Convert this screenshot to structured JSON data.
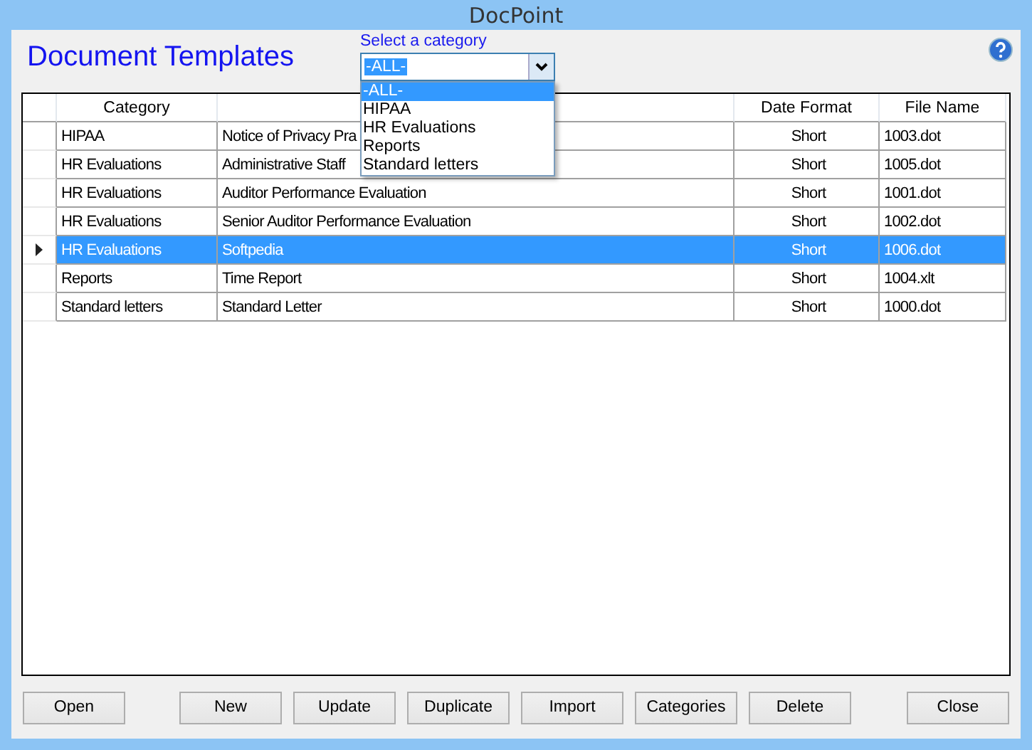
{
  "window": {
    "title": "DocPoint"
  },
  "heading": "Document Templates",
  "category_filter": {
    "label": "Select a category",
    "value": "-ALL-",
    "expanded": true,
    "options": [
      {
        "label": "-ALL-",
        "selected": true
      },
      {
        "label": "HIPAA",
        "selected": false
      },
      {
        "label": "HR Evaluations",
        "selected": false
      },
      {
        "label": "Reports",
        "selected": false
      },
      {
        "label": "Standard letters",
        "selected": false
      }
    ]
  },
  "table": {
    "columns": [
      {
        "kind": "label",
        "label": "Category"
      },
      {
        "kind": "blank"
      },
      {
        "kind": "label",
        "label": "Date Format"
      },
      {
        "kind": "label",
        "label": "File Name"
      }
    ],
    "rows": [
      {
        "category": "HIPAA",
        "template": "Notice of Privacy Pra",
        "date_format": "Short",
        "file_name": "1003.dot",
        "selected": false
      },
      {
        "category": "HR Evaluations",
        "template": "Administrative Staff",
        "date_format": "Short",
        "file_name": "1005.dot",
        "selected": false
      },
      {
        "category": "HR Evaluations",
        "template": "Auditor Performance Evaluation",
        "date_format": "Short",
        "file_name": "1001.dot",
        "selected": false
      },
      {
        "category": "HR Evaluations",
        "template": "Senior Auditor Performance Evaluation",
        "date_format": "Short",
        "file_name": "1002.dot",
        "selected": false
      },
      {
        "category": "HR Evaluations",
        "template": "Softpedia",
        "date_format": "Short",
        "file_name": "1006.dot",
        "selected": true
      },
      {
        "category": "Reports",
        "template": "Time Report",
        "date_format": "Short",
        "file_name": "1004.xlt",
        "selected": false
      },
      {
        "category": "Standard letters",
        "template": "Standard Letter",
        "date_format": "Short",
        "file_name": "1000.dot",
        "selected": false
      }
    ]
  },
  "buttons": [
    "Open",
    "New",
    "Update",
    "Duplicate",
    "Import",
    "Categories",
    "Delete",
    "Close"
  ]
}
